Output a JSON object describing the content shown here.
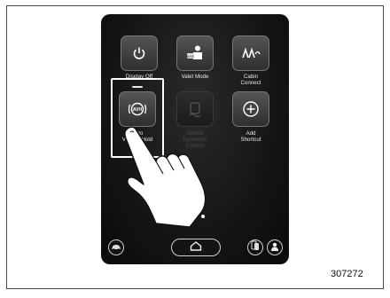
{
  "tiles": [
    {
      "label_lines": [
        "Display Off"
      ],
      "icon": "power-icon"
    },
    {
      "label_lines": [
        "Valet Mode"
      ],
      "icon": "valet-person-icon"
    },
    {
      "label_lines": [
        "Cabin",
        "Connect"
      ],
      "icon": "cabin-connect-icon"
    },
    {
      "label_lines": [
        "Auto",
        "Vehicle Hold"
      ],
      "icon": "avh-icon"
    },
    {
      "label_lines": [
        "Vehicle",
        "Dynamics",
        "Control"
      ],
      "icon": "vehicle-dynamics-icon"
    },
    {
      "label_lines": [
        "Add",
        "Shortcut"
      ],
      "icon": "plus-icon"
    }
  ],
  "pagination": {
    "pages": 2,
    "current": 2
  },
  "bottom_bar": {
    "icons": [
      "car-icon",
      "home-icon",
      "phone-icon",
      "person-icon"
    ]
  },
  "figure_number": "307272",
  "colors": {
    "screen_bg": "#151515",
    "tile_active": "#4a4a4a",
    "text": "#e8e8e8"
  }
}
